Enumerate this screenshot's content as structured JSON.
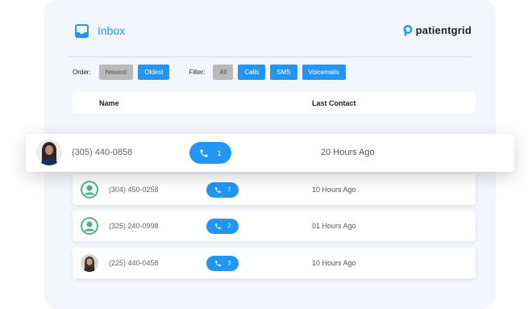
{
  "header": {
    "title": "Inbox",
    "brand": "patientgrid",
    "inbox_icon": "inbox-icon",
    "brand_icon": "patientgrid-logo"
  },
  "controls": {
    "order_label": "Order:",
    "order_options": [
      {
        "label": "Newest",
        "active": false
      },
      {
        "label": "Oldest",
        "active": true
      }
    ],
    "filter_label": "Filter:",
    "filter_options": [
      {
        "label": "All"
      },
      {
        "label": "Calls"
      },
      {
        "label": "SMS"
      },
      {
        "label": "Voicemails"
      }
    ]
  },
  "table": {
    "headers": {
      "name": "Name",
      "last_contact": "Last Contact"
    },
    "featured": {
      "phone": "(305) 440-0858",
      "count": "1",
      "last_contact": "20 Hours Ago",
      "avatar": "photo-avatar"
    },
    "rows": [
      {
        "phone": "(304) 450-0258",
        "count": "7",
        "last_contact": "10 Hours Ago",
        "avatar": "default-user-icon"
      },
      {
        "phone": "(325) 240-0998",
        "count": "2",
        "last_contact": "01 Hours Ago",
        "avatar": "default-user-icon"
      },
      {
        "phone": "(225) 440-0458",
        "count": "3",
        "last_contact": "10 Hours Ago",
        "avatar": "photo-avatar"
      }
    ]
  },
  "colors": {
    "accent": "#2196f3",
    "chip_gray": "#b9b9b9",
    "avatar_green": "#4caf87",
    "card_bg": "#f3f6fd"
  }
}
